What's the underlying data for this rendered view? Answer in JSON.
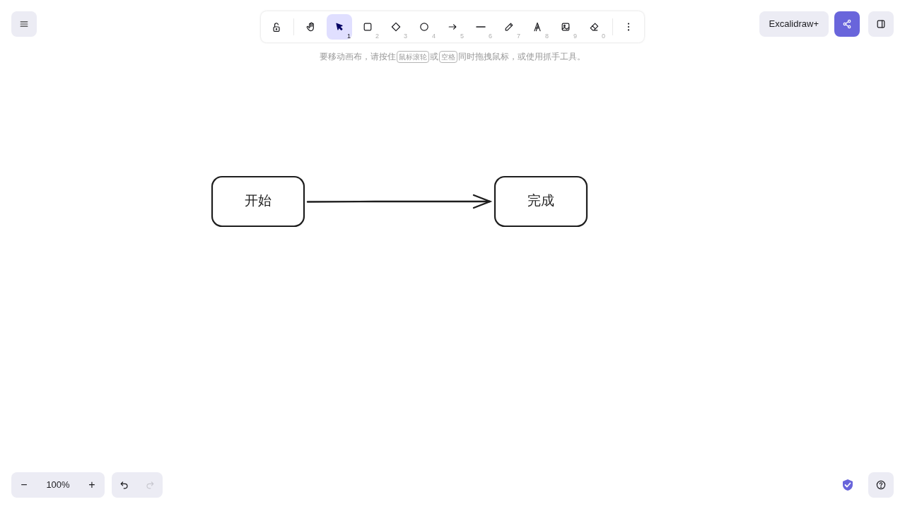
{
  "toolbar": {
    "tools": [
      {
        "kind": "lock",
        "selected": false
      },
      {
        "kind": "hand",
        "selected": false
      },
      {
        "kind": "select",
        "key": "1",
        "selected": true
      },
      {
        "kind": "rectangle",
        "key": "2",
        "selected": false
      },
      {
        "kind": "diamond",
        "key": "3",
        "selected": false
      },
      {
        "kind": "ellipse",
        "key": "4",
        "selected": false
      },
      {
        "kind": "arrow",
        "key": "5",
        "selected": false
      },
      {
        "kind": "line",
        "key": "6",
        "selected": false
      },
      {
        "kind": "pencil",
        "key": "7",
        "selected": false
      },
      {
        "kind": "text",
        "key": "8",
        "selected": false
      },
      {
        "kind": "image",
        "key": "9",
        "selected": false
      },
      {
        "kind": "eraser",
        "key": "0",
        "selected": false
      }
    ]
  },
  "hint": [
    {
      "kind": "text",
      "text": "要移动画布，请按住"
    },
    {
      "kind": "key",
      "text": "鼠标滚轮"
    },
    {
      "kind": "text",
      "text": "或"
    },
    {
      "kind": "key",
      "text": "空格"
    },
    {
      "kind": "text",
      "text": "同时拖拽鼠标，或使用抓手工具。"
    }
  ],
  "top_right": {
    "plus_label": "Excalidraw+"
  },
  "canvas": {
    "nodes": [
      {
        "label": "开始"
      },
      {
        "label": "完成"
      }
    ]
  },
  "zoom": {
    "value": "100%",
    "minus": "−",
    "plus": "+"
  },
  "history": {
    "undo_disabled": false,
    "redo_disabled": true
  }
}
